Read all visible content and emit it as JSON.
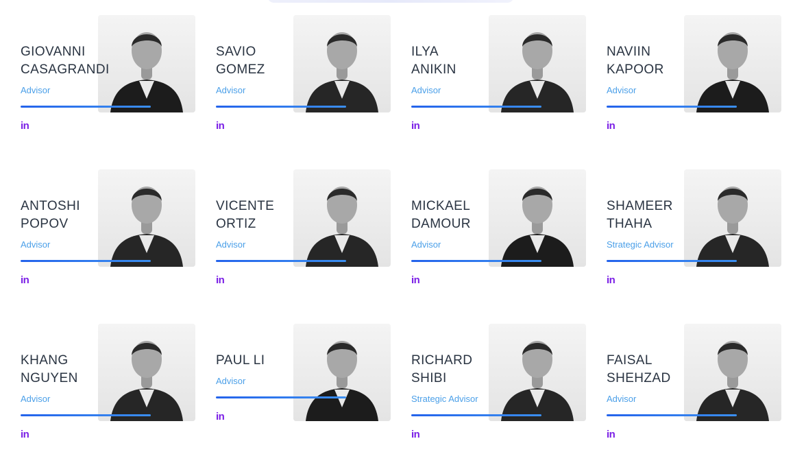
{
  "team": [
    {
      "first": "GIOVANNI",
      "last": "CASAGRANDI",
      "role": "Advisor",
      "linkedin": "in"
    },
    {
      "first": "SAVIO",
      "last": "GOMEZ",
      "role": "Advisor",
      "linkedin": "in"
    },
    {
      "first": "ILYA",
      "last": "ANIKIN",
      "role": "Advisor",
      "linkedin": "in"
    },
    {
      "first": "NAVIIN",
      "last": "KAPOOR",
      "role": "Advisor",
      "linkedin": "in"
    },
    {
      "first": "ANTOSHI",
      "last": "POPOV",
      "role": "Advisor",
      "linkedin": "in"
    },
    {
      "first": "VICENTE",
      "last": "ORTIZ",
      "role": "Advisor",
      "linkedin": "in"
    },
    {
      "first": "MICKAEL",
      "last": "DAMOUR",
      "role": "Advisor",
      "linkedin": "in"
    },
    {
      "first": "SHAMEER",
      "last": "THAHA",
      "role": "Strategic Advisor",
      "linkedin": "in"
    },
    {
      "first": "KHANG",
      "last": "NGUYEN",
      "role": "Advisor",
      "linkedin": "in"
    },
    {
      "first": "PAUL LI",
      "last": "",
      "role": "Advisor",
      "linkedin": "in"
    },
    {
      "first": "RICHARD",
      "last": "SHIBI",
      "role": "Strategic Advisor",
      "linkedin": "in"
    },
    {
      "first": "FAISAL",
      "last": "SHEHZAD",
      "role": "Advisor",
      "linkedin": "in"
    }
  ],
  "colors": {
    "name": "#2a3442",
    "role": "#4a9fe8",
    "bar": "#2463eb",
    "linkedin": "#7a1ee6"
  }
}
